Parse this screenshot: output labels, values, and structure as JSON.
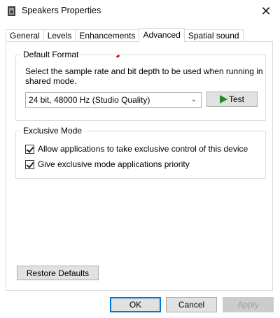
{
  "window": {
    "title": "Speakers Properties",
    "close_glyph": "✕"
  },
  "tabs": [
    {
      "label": "General",
      "active": false
    },
    {
      "label": "Levels",
      "active": false
    },
    {
      "label": "Enhancements",
      "active": false
    },
    {
      "label": "Advanced",
      "active": true
    },
    {
      "label": "Spatial sound",
      "active": false
    }
  ],
  "default_format": {
    "group_label": "Default Format",
    "description": "Select the sample rate and bit depth to be used when running in shared mode.",
    "selected_format": "24 bit, 48000 Hz (Studio Quality)",
    "test_label": "Test"
  },
  "exclusive_mode": {
    "group_label": "Exclusive Mode",
    "options": [
      {
        "label": "Allow applications to take exclusive control of this device",
        "checked": true
      },
      {
        "label": "Give exclusive mode applications priority",
        "checked": true
      }
    ]
  },
  "restore_defaults_label": "Restore Defaults",
  "footer": {
    "ok_label": "OK",
    "cancel_label": "Cancel",
    "apply_label": "Apply",
    "apply_enabled": false
  },
  "colors": {
    "play_icon": "#1c8a2a",
    "ok_border": "#0078d7"
  }
}
